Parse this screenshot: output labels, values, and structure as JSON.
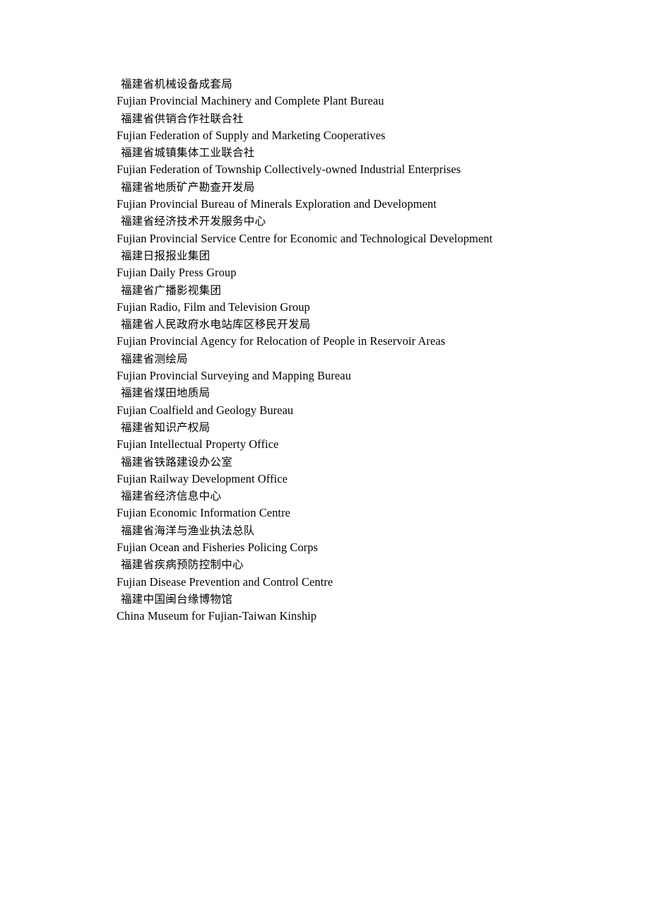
{
  "document": {
    "page_background": "#ffffff",
    "text_color": "#000000",
    "entries": [
      {
        "zh": "福建省机械设备成套局",
        "en": "Fujian Provincial Machinery and Complete Plant Bureau"
      },
      {
        "zh": "福建省供销合作社联合社",
        "en": "Fujian Federation of Supply and Marketing Cooperatives"
      },
      {
        "zh": "福建省城镇集体工业联合社",
        "en": "Fujian Federation of Township Collectively-owned Industrial Enterprises"
      },
      {
        "zh": "福建省地质矿产勘查开发局",
        "en": "Fujian Provincial Bureau of Minerals Exploration and Development"
      },
      {
        "zh": "福建省经济技术开发服务中心",
        "en": "Fujian Provincial Service Centre for Economic and Technological Development"
      },
      {
        "zh": "福建日报报业集团",
        "en": "Fujian Daily Press Group"
      },
      {
        "zh": "福建省广播影视集团",
        "en": "Fujian Radio, Film and Television Group"
      },
      {
        "zh": "福建省人民政府水电站库区移民开发局",
        "en": "Fujian Provincial Agency for Relocation of People in Reservoir Areas"
      },
      {
        "zh": "福建省测绘局",
        "en": "Fujian Provincial Surveying and Mapping Bureau"
      },
      {
        "zh": "福建省煤田地质局",
        "en": "Fujian Coalfield and Geology Bureau"
      },
      {
        "zh": "福建省知识产权局",
        "en": "Fujian Intellectual Property Office"
      },
      {
        "zh": "福建省铁路建设办公室",
        "en": "Fujian Railway Development Office"
      },
      {
        "zh": "福建省经济信息中心",
        "en": "Fujian Economic Information Centre"
      },
      {
        "zh": "福建省海洋与渔业执法总队",
        "en": "Fujian Ocean and Fisheries Policing Corps"
      },
      {
        "zh": "福建省疾病预防控制中心",
        "en": "Fujian Disease Prevention and Control Centre"
      },
      {
        "zh": "福建中国闽台缘博物馆",
        "en": "China Museum for Fujian-Taiwan Kinship"
      }
    ]
  }
}
